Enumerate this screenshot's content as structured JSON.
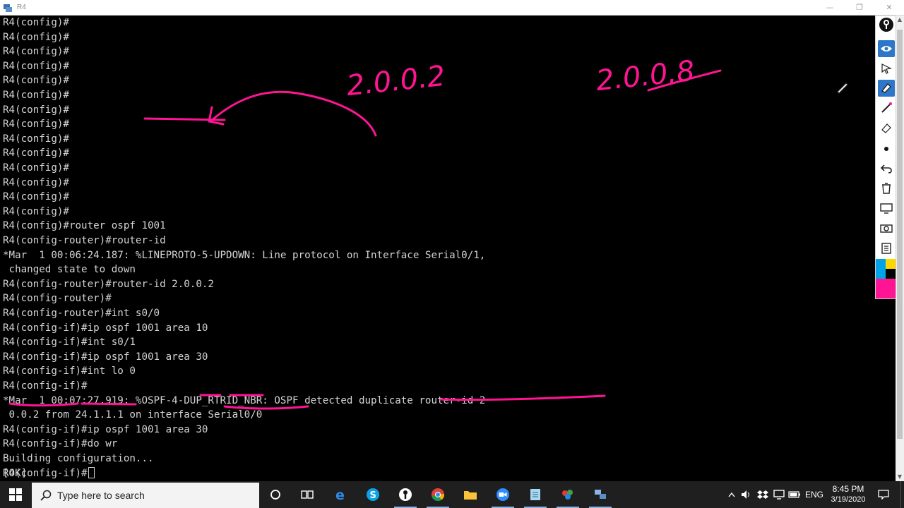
{
  "window": {
    "title": "R4",
    "minimize": "—",
    "maximize": "❐",
    "close": "✕"
  },
  "terminal": {
    "lines": [
      "R4(config)#",
      "R4(config)#",
      "R4(config)#",
      "R4(config)#",
      "R4(config)#",
      "R4(config)#",
      "R4(config)#",
      "R4(config)#",
      "R4(config)#",
      "R4(config)#",
      "R4(config)#",
      "R4(config)#",
      "R4(config)#",
      "R4(config)#",
      "R4(config)#router ospf 1001",
      "R4(config-router)#router-id",
      "*Mar  1 00:06:24.187: %LINEPROTO-5-UPDOWN: Line protocol on Interface Serial0/1,",
      " changed state to down",
      "R4(config-router)#router-id 2.0.0.2",
      "R4(config-router)#",
      "R4(config-router)#int s0/0",
      "R4(config-if)#ip ospf 1001 area 10",
      "R4(config-if)#int s0/1",
      "R4(config-if)#ip ospf 1001 area 30",
      "R4(config-if)#int lo 0",
      "R4(config-if)#",
      "*Mar  1 00:07:27.919: %OSPF-4-DUP_RTRID_NBR: OSPF detected duplicate router-id 2",
      " 0.0.2 from 24.1.1.1 on interface Serial0/0",
      "R4(config-if)#ip ospf 1001 area 30",
      "R4(config-if)#do wr",
      "Building configuration...",
      "[OK]"
    ],
    "prompt": "R4(config-if)#"
  },
  "annotations": {
    "left_label": "2.0.0.2",
    "right_label": "2.0.0.8",
    "ink_color": "#ff1493"
  },
  "toolbar": {
    "tools": [
      "logo-icon",
      "eye-icon",
      "pointer-icon",
      "highlighter-icon",
      "pen-icon",
      "eraser-icon",
      "dot-icon",
      "undo-icon",
      "trash-icon",
      "whiteboard-icon",
      "camera-icon",
      "clipboard-icon"
    ],
    "palette": [
      "#00a2e8",
      "#ffd700",
      "#000000",
      "#ff1493"
    ]
  },
  "taskbar": {
    "search_placeholder": "Type here to search",
    "apps": [
      "cortana-icon",
      "task-view-icon",
      "edge-icon",
      "skype-icon",
      "gns3-icon",
      "chrome-icon",
      "file-explorer-icon",
      "zoom-icon",
      "notepad-icon",
      "paint-icon",
      "network-icon"
    ],
    "language": "ENG",
    "time": "8:45 PM",
    "date": "3/19/2020"
  }
}
